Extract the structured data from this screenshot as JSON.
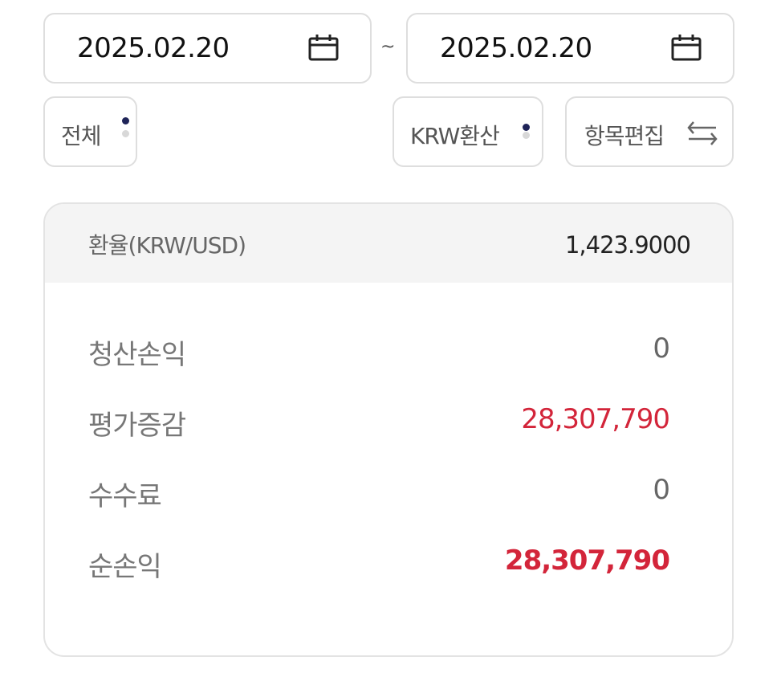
{
  "date_range": {
    "start": "2025.02.20",
    "separator": "~",
    "end": "2025.02.20"
  },
  "filters": {
    "category_label": "전체",
    "currency_label": "KRW환산",
    "edit_label": "항목편집"
  },
  "summary": {
    "rate_label": "환율(KRW/USD)",
    "rate_value": "1,423.9000",
    "rows": [
      {
        "label": "청산손익",
        "value": "0"
      },
      {
        "label": "평가증감",
        "value": "28,307,790"
      },
      {
        "label": "수수료",
        "value": "0"
      },
      {
        "label": "순손익",
        "value": "28,307,790"
      }
    ]
  },
  "colors": {
    "positive": "#d3253a",
    "accent_dot": "#1f2458",
    "border": "#dedede"
  },
  "icons": {
    "calendar": "calendar-icon",
    "swap": "swap-arrows-icon",
    "select_indicator": "vertical-dots-icon"
  }
}
